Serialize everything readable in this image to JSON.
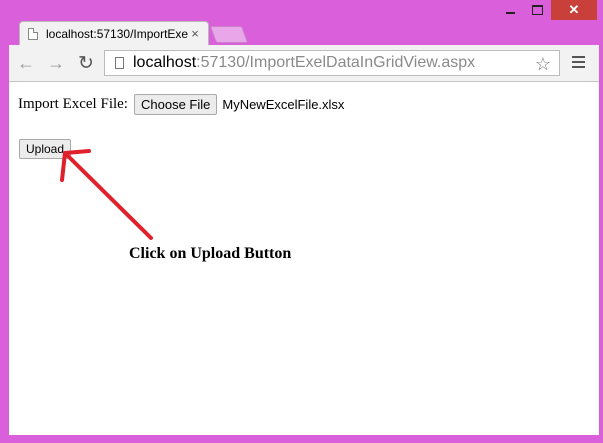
{
  "browser": {
    "tab_title": "localhost:57130/ImportExe",
    "tab_close": "×",
    "url_host": "localhost",
    "url_path": ":57130/ImportExelDataInGridView.aspx",
    "window_close": "✕"
  },
  "page": {
    "file_label": "Import Excel File:",
    "choose_button": "Choose File",
    "file_name": "MyNewExcelFile.xlsx",
    "upload_button": "Upload",
    "annotation": "Click on Upload Button"
  },
  "colors": {
    "window_frame": "#da5fda",
    "close_button": "#c9403b",
    "arrow": "#e0202a"
  },
  "icons": [
    "page-icon",
    "back-arrow-icon",
    "forward-arrow-icon",
    "reload-icon",
    "star-icon",
    "menu-icon",
    "close-icon",
    "minimize-icon",
    "maximize-icon"
  ]
}
